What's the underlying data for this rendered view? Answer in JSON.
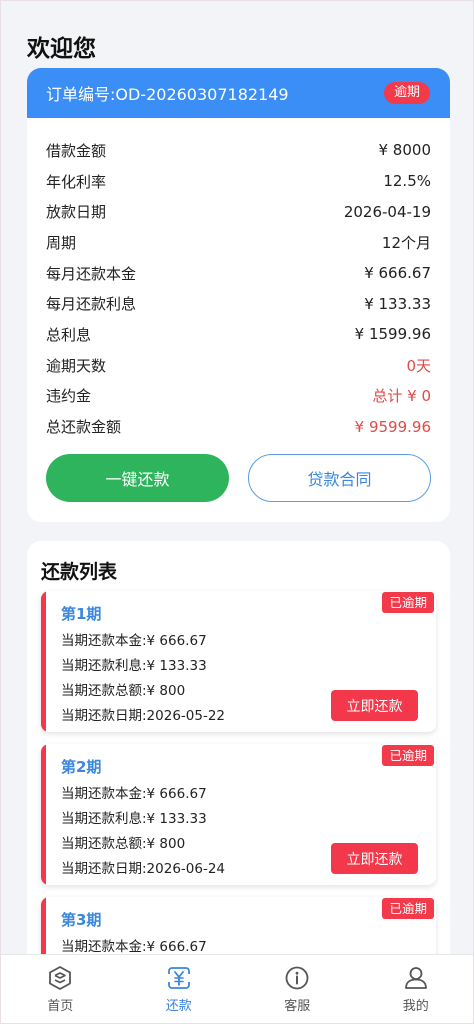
{
  "welcome": "欢迎您",
  "order": {
    "number": "订单编号:OD-20260307182149",
    "status": "逾期",
    "rows": [
      {
        "label": "借款金额",
        "value": "¥ 8000",
        "red": false
      },
      {
        "label": "年化利率",
        "value": "12.5%",
        "red": false
      },
      {
        "label": "放款日期",
        "value": "2026-04-19",
        "red": false
      },
      {
        "label": "周期",
        "value": "12个月",
        "red": false
      },
      {
        "label": "每月还款本金",
        "value": "¥ 666.67",
        "red": false
      },
      {
        "label": "每月还款利息",
        "value": "¥ 133.33",
        "red": false
      },
      {
        "label": "总利息",
        "value": "¥ 1599.96",
        "red": false
      },
      {
        "label": "逾期天数",
        "value": "0天",
        "red": true
      },
      {
        "label": "违约金",
        "value": "总计 ¥ 0",
        "red": true
      },
      {
        "label": "总还款金额",
        "value": "¥ 9599.96",
        "red": true
      }
    ],
    "repay_button": "一键还款",
    "contract_button": "贷款合同"
  },
  "repay_list": {
    "title": "还款列表",
    "periods": [
      {
        "name": "第1期",
        "principal": "当期还款本金:¥ 666.67",
        "interest": "当期还款利息:¥ 133.33",
        "total": "当期还款总额:¥ 800",
        "date": "当期还款日期:2026-05-22",
        "badge": "已逾期",
        "button": "立即还款"
      },
      {
        "name": "第2期",
        "principal": "当期还款本金:¥ 666.67",
        "interest": "当期还款利息:¥ 133.33",
        "total": "当期还款总额:¥ 800",
        "date": "当期还款日期:2026-06-24",
        "badge": "已逾期",
        "button": "立即还款"
      },
      {
        "name": "第3期",
        "principal": "当期还款本金:¥ 666.67",
        "interest": "",
        "total": "",
        "date": "",
        "badge": "已逾期",
        "button": ""
      }
    ]
  },
  "tabbar": {
    "home": "首页",
    "repay": "还款",
    "service": "客服",
    "mine": "我的",
    "active_color": "#3a86e0"
  }
}
